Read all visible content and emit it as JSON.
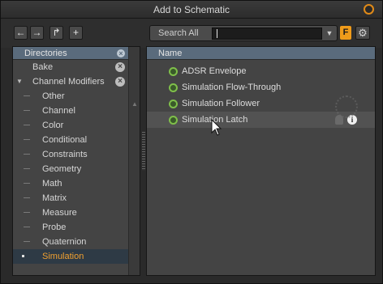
{
  "window": {
    "title": "Add to Schematic"
  },
  "toolbar": {
    "back_icon": "arrow-left-icon",
    "forward_icon": "arrow-right-icon",
    "up_icon": "up-level-icon",
    "add_icon": "plus-icon",
    "search_label": "Search All",
    "search_value": "",
    "filter_label": "F",
    "gear_icon": "gear-icon"
  },
  "directories": {
    "header": "Directories",
    "items": [
      {
        "label": "Bake",
        "level": 0,
        "removable": true
      },
      {
        "label": "Channel Modifiers",
        "level": 0,
        "expanded": true,
        "removable": true
      },
      {
        "label": "Other",
        "level": 1
      },
      {
        "label": "Channel",
        "level": 1
      },
      {
        "label": "Color",
        "level": 1
      },
      {
        "label": "Conditional",
        "level": 1
      },
      {
        "label": "Constraints",
        "level": 1
      },
      {
        "label": "Geometry",
        "level": 1
      },
      {
        "label": "Math",
        "level": 1
      },
      {
        "label": "Matrix",
        "level": 1
      },
      {
        "label": "Measure",
        "level": 1
      },
      {
        "label": "Probe",
        "level": 1
      },
      {
        "label": "Quaternion",
        "level": 1
      },
      {
        "label": "Simulation",
        "level": 1,
        "selected": true
      }
    ]
  },
  "results": {
    "header": "Name",
    "items": [
      {
        "label": "ADSR Envelope"
      },
      {
        "label": "Simulation Flow-Through"
      },
      {
        "label": "Simulation Follower"
      },
      {
        "label": "Simulation Latch",
        "hovered": true
      }
    ]
  },
  "colors": {
    "accent": "#ef9b1a",
    "selected_text": "#f0a030",
    "header_bg": "#5a6b7c",
    "node_icon": "#7fbf4a"
  }
}
